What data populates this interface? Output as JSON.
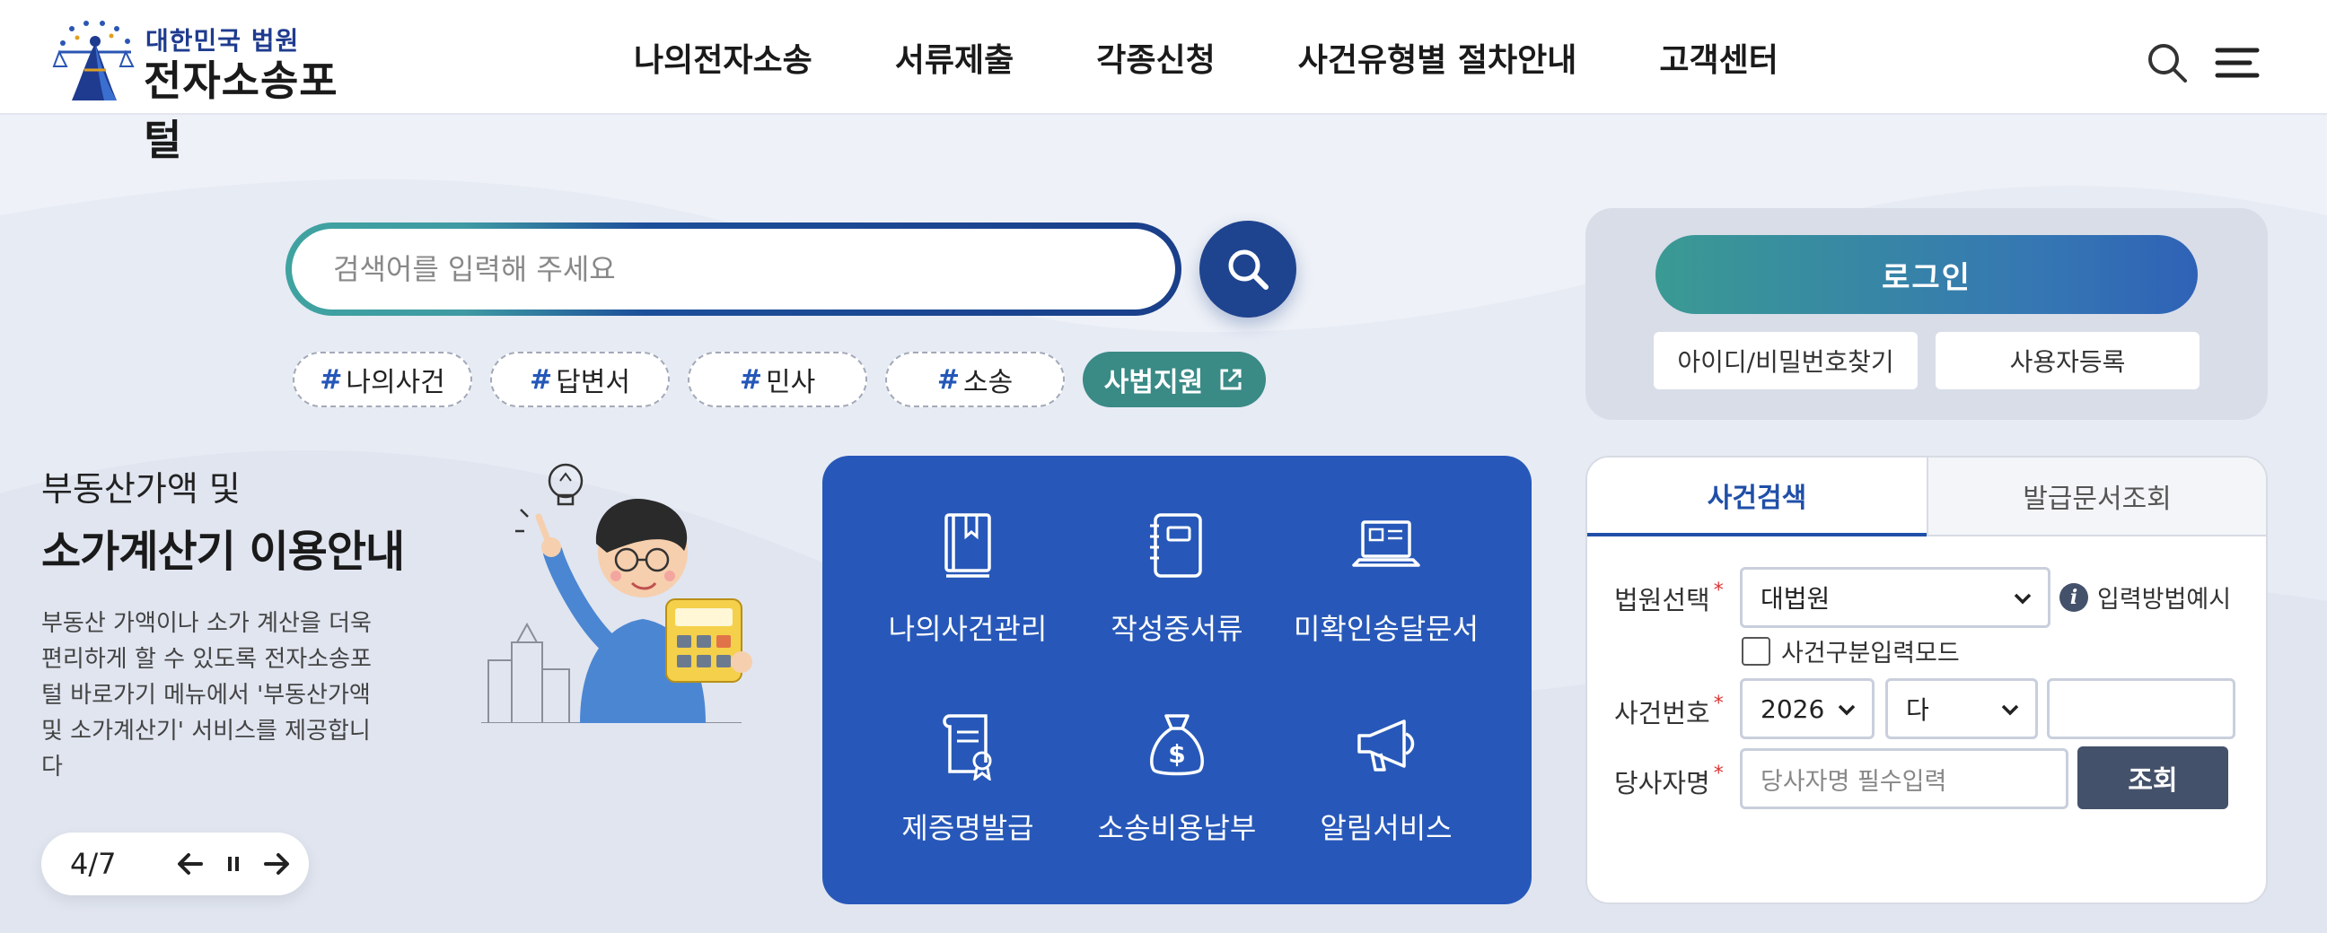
{
  "header": {
    "logo_small": "대한민국 법원",
    "logo_big": "전자소송포털",
    "nav": [
      "나의전자소송",
      "서류제출",
      "각종신청",
      "사건유형별 절차안내",
      "고객센터"
    ]
  },
  "search": {
    "placeholder": "검색어를 입력해 주세요"
  },
  "tags": {
    "items": [
      "나의사건",
      "답변서",
      "민사",
      "소송"
    ],
    "hash": "#",
    "external": "사법지원"
  },
  "promo": {
    "subtitle": "부동산가액 및",
    "title": "소가계산기 이용안내",
    "description": "부동산 가액이나 소가 계산을 더욱 편리하게 할 수 있도록 전자소송포털 바로가기 메뉴에서 '부동산가액 및 소가계산기' 서비스를 제공합니다",
    "slide_counter": "4/7"
  },
  "quick_menu": [
    {
      "label": "나의사건관리",
      "icon": "book-icon"
    },
    {
      "label": "작성중서류",
      "icon": "notebook-icon"
    },
    {
      "label": "미확인송달문서",
      "icon": "laptop-icon"
    },
    {
      "label": "제증명발급",
      "icon": "certificate-scroll-icon"
    },
    {
      "label": "소송비용납부",
      "icon": "money-bag-icon"
    },
    {
      "label": "알림서비스",
      "icon": "megaphone-icon"
    }
  ],
  "login": {
    "button": "로그인",
    "find_account": "아이디/비밀번호찾기",
    "register": "사용자등록"
  },
  "case_search": {
    "tabs": [
      "사건검색",
      "발급문서조회"
    ],
    "court_label": "법원선택",
    "court_value": "대법원",
    "help_text": "입력방법예시",
    "mode_checkbox": "사건구분입력모드",
    "case_no_label": "사건번호",
    "year_value": "2026",
    "type_value": "다",
    "number_value": "",
    "party_label": "당사자명",
    "party_placeholder": "당사자명 필수입력",
    "query_button": "조회",
    "required_mark": "*"
  },
  "colors": {
    "brand_blue": "#2758b9",
    "navy": "#1f448f",
    "teal": "#3a8a86",
    "button_slate": "#44516a"
  }
}
